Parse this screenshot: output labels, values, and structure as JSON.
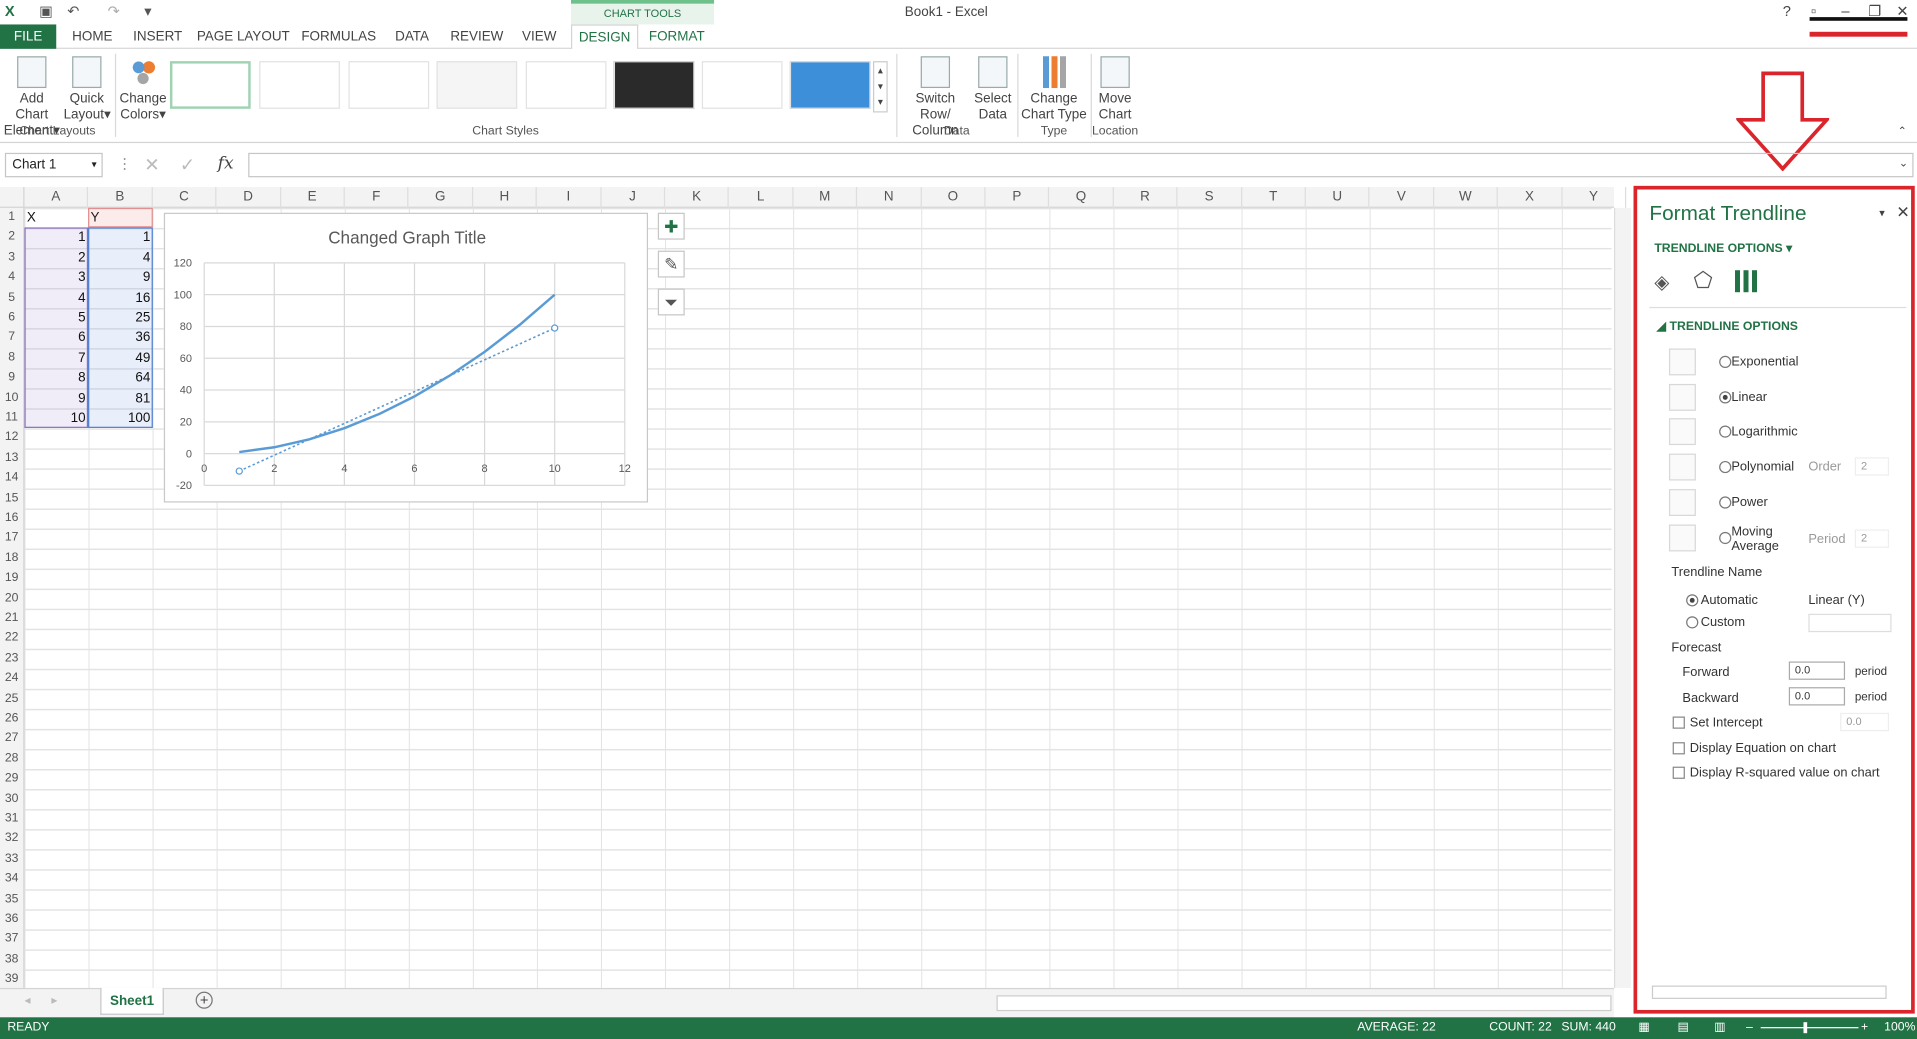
{
  "window": {
    "title": "Book1 - Excel",
    "help": "?"
  },
  "ribbon": {
    "tabs": [
      "FILE",
      "HOME",
      "INSERT",
      "PAGE LAYOUT",
      "FORMULAS",
      "DATA",
      "REVIEW",
      "VIEW",
      "DESIGN",
      "FORMAT"
    ],
    "context_tab": "CHART TOOLS",
    "buttons": {
      "add_chart": "Add Chart",
      "add_chart2": "Element",
      "quick": "Quick",
      "quick2": "Layout",
      "colors": "Change",
      "colors2": "Colors",
      "switch": "Switch Row/",
      "switch2": "Column",
      "select": "Select",
      "select2": "Data",
      "ctype": "Change",
      "ctype2": "Chart Type",
      "move": "Move",
      "move2": "Chart"
    },
    "groups": {
      "layouts": "Chart Layouts",
      "styles": "Chart Styles",
      "data": "Data",
      "type": "Type",
      "location": "Location"
    }
  },
  "formula": {
    "namebox": "Chart 1",
    "fx": "fx"
  },
  "columns": [
    "A",
    "B",
    "C",
    "D",
    "E",
    "F",
    "G",
    "H",
    "I",
    "J",
    "K",
    "L",
    "M",
    "N",
    "O",
    "P",
    "Q",
    "R",
    "S",
    "T",
    "U",
    "V",
    "W",
    "X",
    "Y"
  ],
  "rows": [
    "1",
    "2",
    "3",
    "4",
    "5",
    "6",
    "7",
    "8",
    "9",
    "10",
    "11",
    "12",
    "13",
    "14",
    "15",
    "16",
    "17",
    "18",
    "19",
    "20",
    "21",
    "22",
    "23",
    "24",
    "25",
    "26",
    "27",
    "28",
    "29",
    "30",
    "31",
    "32",
    "33",
    "34",
    "35",
    "36",
    "37",
    "38",
    "39"
  ],
  "table": {
    "hx": "X",
    "hy": "Y",
    "x": [
      "1",
      "2",
      "3",
      "4",
      "5",
      "6",
      "7",
      "8",
      "9",
      "10"
    ],
    "y": [
      "1",
      "4",
      "9",
      "16",
      "25",
      "36",
      "49",
      "64",
      "81",
      "100"
    ]
  },
  "chart_data": {
    "type": "line",
    "title": "Changed Graph Title",
    "x": [
      1,
      2,
      3,
      4,
      5,
      6,
      7,
      8,
      9,
      10
    ],
    "series": [
      {
        "values": [
          1,
          4,
          9,
          16,
          25,
          36,
          49,
          64,
          81,
          100
        ]
      },
      {
        "values": [
          -11,
          -1,
          9,
          19,
          29,
          39,
          49,
          59,
          69,
          79
        ],
        "style": "dotted trendline"
      }
    ],
    "xlim": [
      0,
      12
    ],
    "ylim": [
      -20,
      120
    ],
    "xticks": [
      "0",
      "2",
      "4",
      "6",
      "8",
      "10",
      "12"
    ],
    "yticks": [
      "-20",
      "0",
      "20",
      "40",
      "60",
      "80",
      "100",
      "120"
    ],
    "grid": true,
    "color": "#5b9bd5"
  },
  "sheet": {
    "tab": "Sheet1"
  },
  "status": {
    "ready": "READY",
    "avg": "AVERAGE: 22",
    "count": "COUNT: 22",
    "sum": "SUM: 440",
    "zoom": "100%"
  },
  "pane": {
    "title": "Format Trendline",
    "menu": "TRENDLINE OPTIONS",
    "section": "TRENDLINE OPTIONS",
    "options": [
      "Exponential",
      "Linear",
      "Logarithmic",
      "Polynomial",
      "Power",
      "Moving"
    ],
    "moving2": "Average",
    "order": "Order",
    "order_val": "2",
    "period": "Period",
    "period_val": "2",
    "name_hdr": "Trendline Name",
    "automatic": "Automatic",
    "auto_val": "Linear (Y)",
    "custom": "Custom",
    "forecast": "Forecast",
    "forward": "Forward",
    "fwd_val": "0.0",
    "backward": "Backward",
    "bwd_val": "0.0",
    "periods": "period",
    "intercept": "Set Intercept",
    "int_val": "0.0",
    "equation": "Display Equation on chart",
    "rsq": "Display R-squared value on chart"
  }
}
